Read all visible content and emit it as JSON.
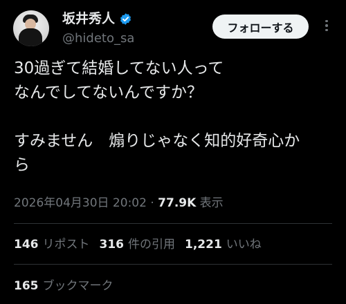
{
  "user": {
    "display_name": "坂井秀人",
    "handle": "@hideto_sa",
    "verified_icon": "verified-badge-icon",
    "avatar_icon": "user-avatar"
  },
  "follow_button": {
    "label": "フォローする"
  },
  "more_icon": "more-dots-icon",
  "tweet": {
    "text": "30過ぎて結婚してない人って\nなんでしてないんですか？\n\nすみません　煽りじゃなく知的好奇心か\nら"
  },
  "meta": {
    "timestamp": "2026年04月30日 20:02",
    "separator": " · ",
    "views_count": "77.9K",
    "views_label": " 表示"
  },
  "stats": {
    "reposts": {
      "count": "146",
      "label": "リポスト"
    },
    "quotes": {
      "count": "316",
      "label": "件の引用"
    },
    "likes": {
      "count": "1,221",
      "label": "いいね"
    },
    "bookmarks": {
      "count": "165",
      "label": "ブックマーク"
    }
  },
  "colors": {
    "background": "#000000",
    "text_primary": "#e7e9ea",
    "text_secondary": "#71767b",
    "verified": "#1d9bf0",
    "button_bg": "#eff3f4",
    "divider": "#2f3336"
  }
}
